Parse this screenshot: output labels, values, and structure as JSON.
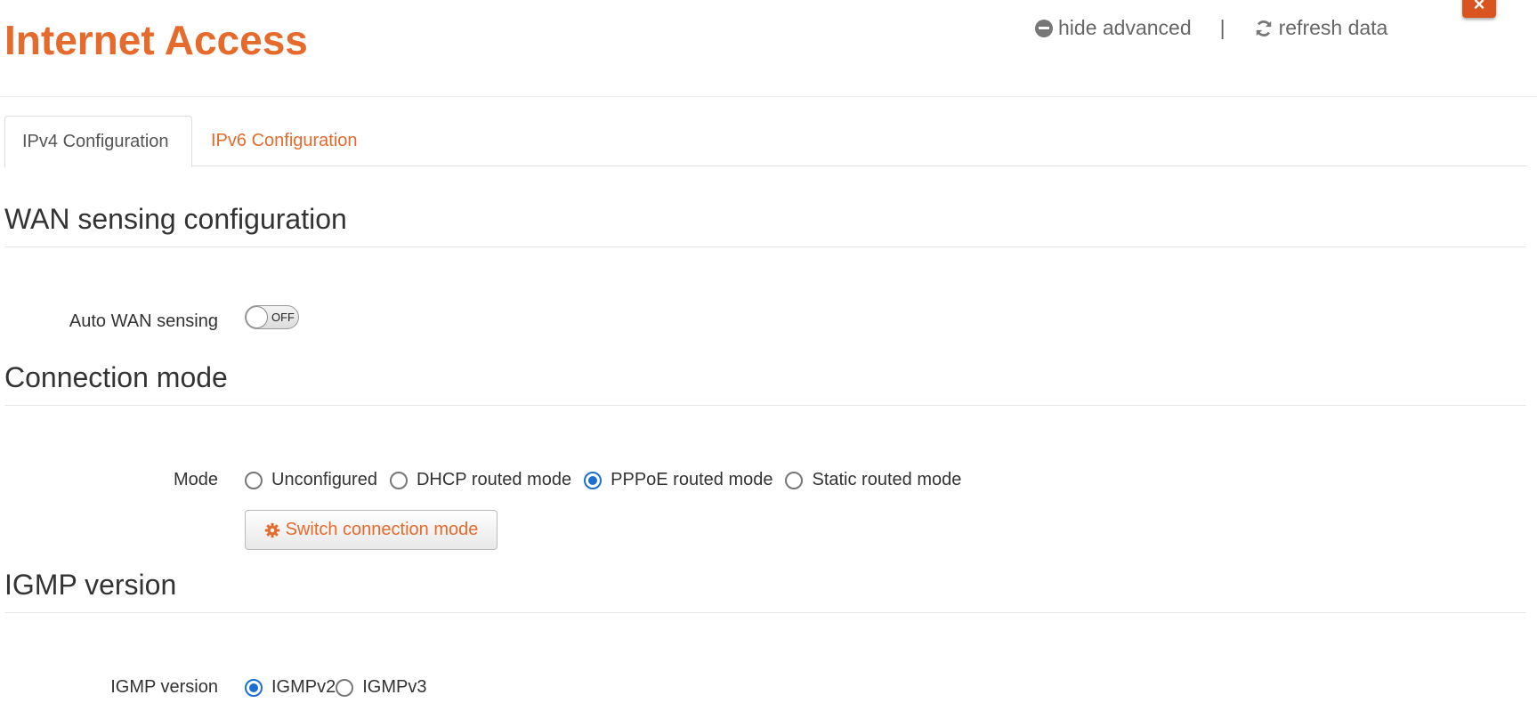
{
  "header": {
    "title": "Internet Access",
    "hide_advanced": "hide advanced",
    "separator": "|",
    "refresh_data": "refresh data",
    "close_glyph": "×"
  },
  "tabs": [
    {
      "label": "IPv4 Configuration",
      "active": true
    },
    {
      "label": "IPv6 Configuration",
      "active": false
    }
  ],
  "wan_sensing": {
    "title": "WAN sensing configuration",
    "auto_label": "Auto WAN sensing",
    "toggle_state": "OFF"
  },
  "connection_mode": {
    "title": "Connection mode",
    "mode_label": "Mode",
    "options": [
      {
        "label": "Unconfigured",
        "checked": false
      },
      {
        "label": "DHCP routed mode",
        "checked": false
      },
      {
        "label": "PPPoE routed mode",
        "checked": true
      },
      {
        "label": "Static routed mode",
        "checked": false
      }
    ],
    "switch_button": "Switch connection mode"
  },
  "igmp": {
    "title": "IGMP version",
    "label": "IGMP version",
    "options": [
      {
        "label": "IGMPv2",
        "checked": true
      },
      {
        "label": "IGMPv3",
        "checked": false
      }
    ]
  },
  "colors": {
    "accent": "#e66a2c",
    "close_button": "#d9541e",
    "radio_checked": "#1a6fd0"
  },
  "icons": {
    "hide_advanced": "minus-circle-icon",
    "refresh_data": "refresh-icon",
    "switch_button": "gear-icon",
    "close": "close-icon"
  }
}
